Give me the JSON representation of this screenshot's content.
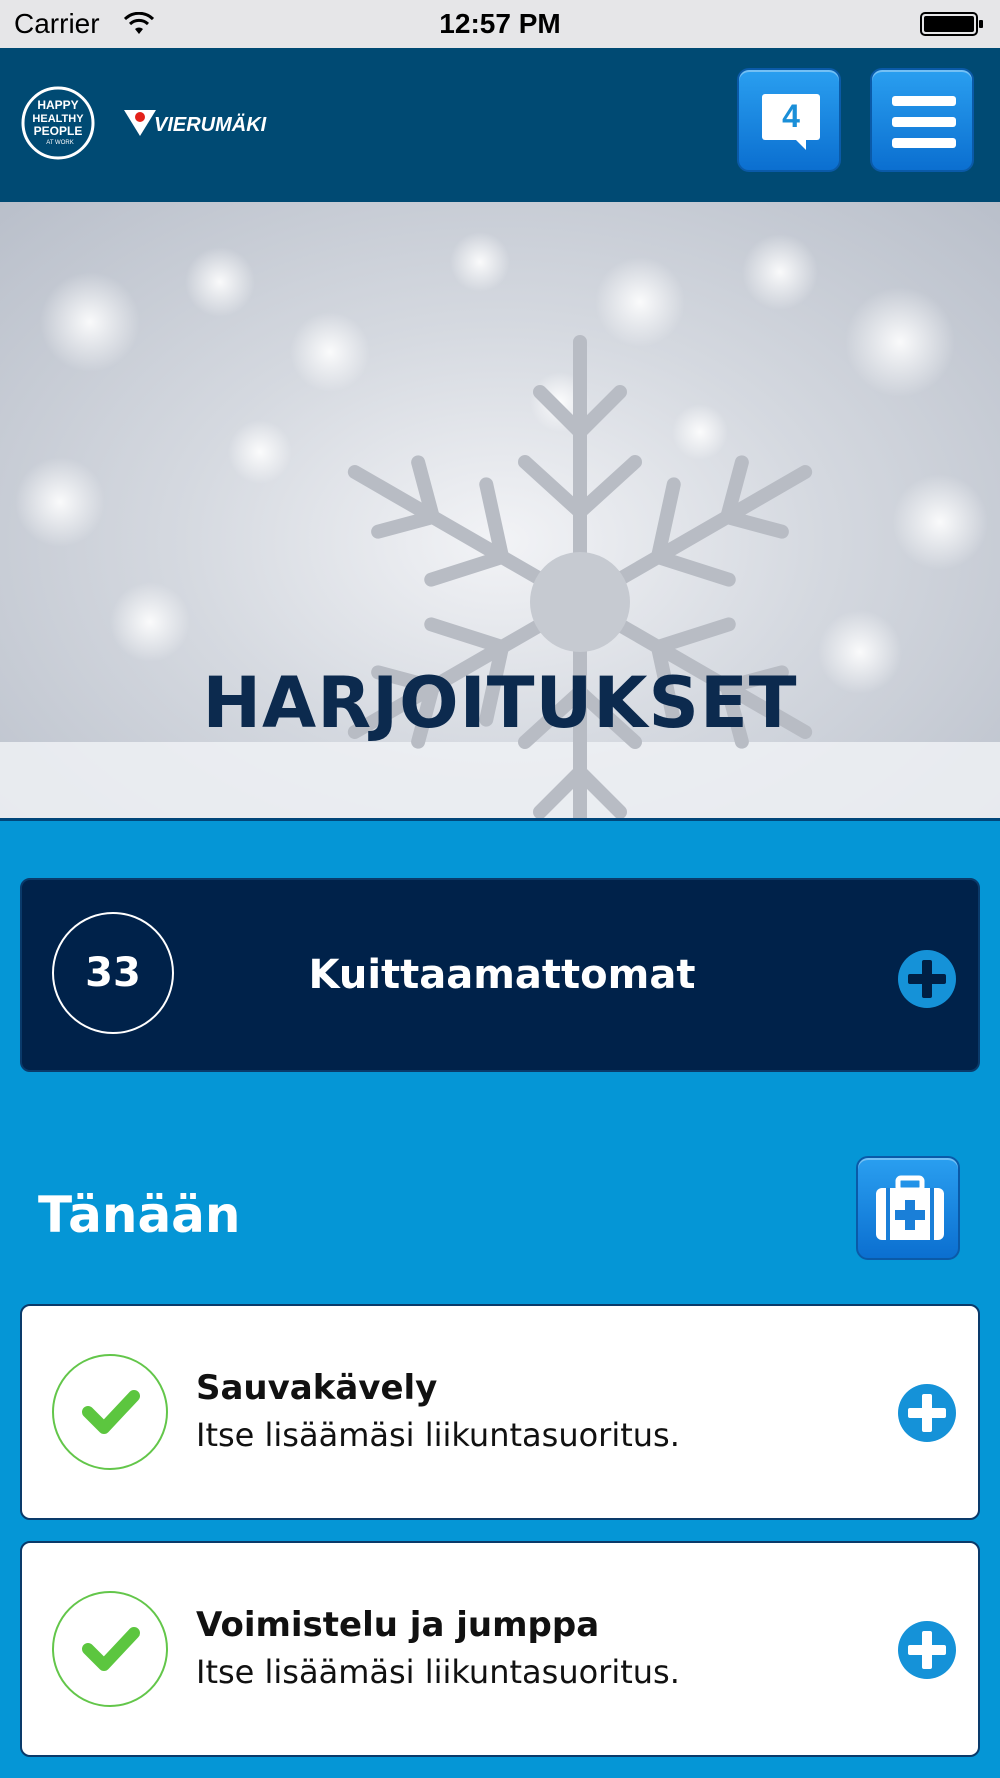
{
  "status_bar": {
    "carrier": "Carrier",
    "time": "12:57 PM",
    "wifi_icon": "wifi-icon",
    "battery_icon": "battery-icon"
  },
  "header": {
    "logo_primary": "happy-healthy-people-logo",
    "logo_primary_text": [
      "HAPPY",
      "HEALTHY",
      "PEOPLE",
      "AT WORK"
    ],
    "logo_secondary": "VIERUMÄKI",
    "notification_count": "4",
    "notification_icon": "chat-bubble-icon",
    "menu_icon": "hamburger-menu-icon",
    "color": "#004a73"
  },
  "hero": {
    "title": "HARJOITUKSET",
    "image": "snowflake-image"
  },
  "pending": {
    "count": "33",
    "label": "Kuittaamattomat",
    "icon": "plus-circle-icon"
  },
  "today": {
    "title": "Tänään",
    "first_aid_icon": "first-aid-kit-icon",
    "items": [
      {
        "name": "Sauvakävely",
        "description": "Itse lisäämäsi liikuntasuoritus.",
        "status_icon": "checkmark-icon",
        "action_icon": "plus-circle-icon"
      },
      {
        "name": "Voimistelu ja jumppa",
        "description": "Itse lisäämäsi liikuntasuoritus.",
        "status_icon": "checkmark-icon",
        "action_icon": "plus-circle-icon"
      }
    ]
  },
  "colors": {
    "background": "#0596d6",
    "dark_navy": "#00224a",
    "accent_blue": "#1592d8",
    "check_green": "#63c64a"
  }
}
